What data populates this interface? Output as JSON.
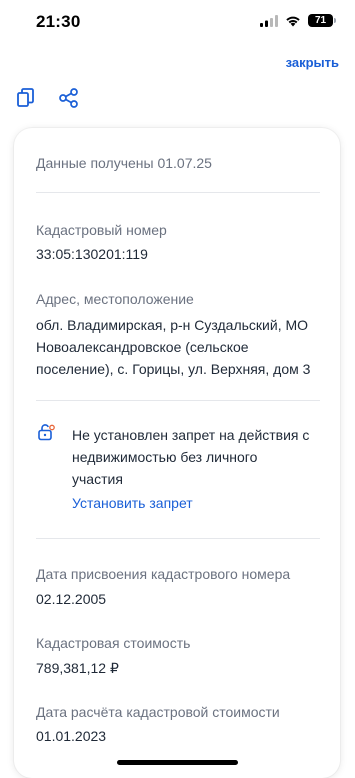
{
  "status_bar": {
    "time": "21:30",
    "battery": "71"
  },
  "header": {
    "close_label": "закрыть"
  },
  "toolbar": {
    "copy_icon": "copy-icon",
    "share_icon": "share-icon"
  },
  "card": {
    "received": "Данные получены 01.07.25",
    "cadastral_number_label": "Кадастровый номер",
    "cadastral_number": "33:05:130201:119",
    "address_label": "Адрес, местоположение",
    "address_lines": [
      "обл. Владимирская, р-н Суздальский, МО",
      "Новоалександровское (сельское",
      "поселение), с. Горицы, ул. Верхняя, дом 3"
    ],
    "restriction_lines": [
      "Не установлен запрет на действия с",
      "недвижимостью без личного",
      "участия"
    ],
    "set_restriction_label": "Установить запрет",
    "assign_date_label": "Дата присвоения кадастрового номера",
    "assign_date": "02.12.2005",
    "cost_label": "Кадастровая стоимость",
    "cost": "789,381,12 ₽",
    "calc_date_label": "Дата расчёта кадастровой стоимости",
    "calc_date": "01.01.2023"
  },
  "colors": {
    "accent": "#1a5fd7",
    "muted_text": "#6b7280",
    "text": "#1f2937"
  }
}
